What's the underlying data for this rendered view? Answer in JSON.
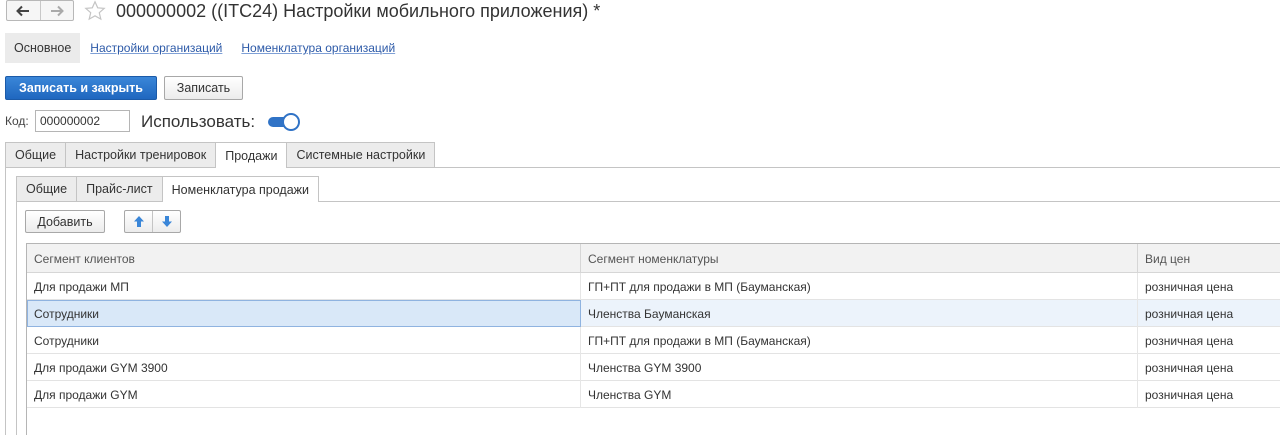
{
  "window": {
    "title": "000000002 ((ITC24) Настройки мобильного приложения) *"
  },
  "sections": {
    "current": "Основное",
    "links": [
      "Настройки организаций",
      "Номенклатура организаций"
    ]
  },
  "commands": {
    "save_close": "Записать и закрыть",
    "save": "Записать"
  },
  "form": {
    "code_label": "Код:",
    "code_value": "000000002",
    "use_label": "Использовать:",
    "use_enabled": true
  },
  "tabs": {
    "main": [
      "Общие",
      "Настройки тренировок",
      "Продажи",
      "Системные настройки"
    ],
    "main_active": "Продажи",
    "sub": [
      "Общие",
      "Прайс-лист",
      "Номенклатура продажи"
    ],
    "sub_active": "Номенклатура продажи"
  },
  "table": {
    "add_label": "Добавить",
    "columns": [
      "Сегмент клиентов",
      "Сегмент номенклатуры",
      "Вид цен"
    ],
    "rows": [
      [
        "Для продажи МП",
        "ГП+ПТ для продажи в МП (Бауманская)",
        "розничная цена"
      ],
      [
        "Сотрудники",
        "Членства Бауманская",
        "розничная цена"
      ],
      [
        "Сотрудники",
        "ГП+ПТ для продажи в МП (Бауманская)",
        "розничная цена"
      ],
      [
        "Для продажи GYM 3900",
        "Членства GYM 3900",
        "розничная цена"
      ],
      [
        "Для продажи GYM",
        "Членства GYM",
        "розничная цена"
      ]
    ],
    "selected_row": 2
  },
  "colors": {
    "accent": "#1f67bf",
    "link": "#2d5aa8",
    "selection": "#d9e8f8"
  }
}
